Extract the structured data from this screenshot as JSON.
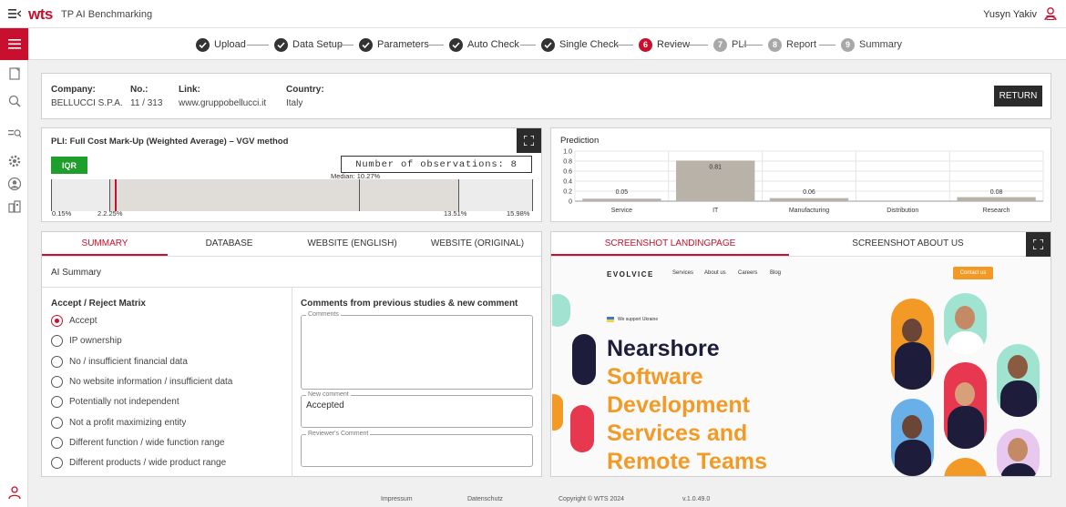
{
  "app": {
    "brand": "wts",
    "title": "TP AI Benchmarking",
    "user": "Yusyn Yakiv"
  },
  "steps": [
    {
      "label": "Upload",
      "number": "1",
      "state": "done"
    },
    {
      "label": "Data Setup",
      "number": "2",
      "state": "done"
    },
    {
      "label": "Parameters",
      "number": "3",
      "state": "done"
    },
    {
      "label": "Auto Check",
      "number": "4",
      "state": "done"
    },
    {
      "label": "Single Check",
      "number": "5",
      "state": "done"
    },
    {
      "label": "Review",
      "number": "6",
      "state": "active"
    },
    {
      "label": "PLI",
      "number": "7",
      "state": "pending"
    },
    {
      "label": "Report",
      "number": "8",
      "state": "pending"
    },
    {
      "label": "Summary",
      "number": "9",
      "state": "pending"
    }
  ],
  "company": {
    "company_label": "Company:",
    "company_value": "BELLUCCI S.P.A.",
    "no_label": "No.:",
    "no_value": "11 / 313",
    "link_label": "Link:",
    "link_value": "www.gruppobellucci.it",
    "country_label": "Country:",
    "country_value": "Italy",
    "return_label": "RETURN"
  },
  "pli": {
    "title": "PLI: Full Cost Mark-Up (Weighted Average) – VGV method",
    "iqr_label": "IQR",
    "observations": "Number of observations: 8",
    "median_label": "Median: 10.27%",
    "min_label": "0.15%",
    "q1_label": "2.2.25%",
    "q3_label": "13.51%",
    "max_label": "15.98%"
  },
  "chart_data": {
    "type": "bar",
    "title": "Prediction",
    "categories": [
      "Service",
      "IT",
      "Manufacturing",
      "Distribution",
      "Research"
    ],
    "values": [
      0.05,
      0.81,
      0.06,
      0,
      0.08
    ],
    "value_labels": [
      "0.05",
      "0.81",
      "0.06",
      "",
      "0.08"
    ],
    "ylim": [
      0,
      1.0
    ],
    "yticks": [
      "0",
      "0.2",
      "0.4",
      "0.6",
      "0.8",
      "1.0"
    ],
    "grid": true,
    "bar_color": "#b9b2a8"
  },
  "tabs_left": [
    "SUMMARY",
    "DATABASE",
    "WEBSITE (ENGLISH)",
    "WEBSITE (ORIGINAL)"
  ],
  "ai_summary_label": "AI Summary",
  "matrix": {
    "title": "Accept / Reject Matrix",
    "options": [
      "Accept",
      "IP ownership",
      "No / insufficient financial data",
      "No website information / insufficient data",
      "Potentially not independent",
      "Not a profit maximizing entity",
      "Different function / wide function range",
      "Different products / wide product range"
    ],
    "selected": "Accept"
  },
  "comments": {
    "title": "Comments from previous studies & new comment",
    "comments_legend": "Comments",
    "new_comment_legend": "New comment",
    "new_comment_value": "Accepted",
    "reviewer_legend": "Reviewer's Comment"
  },
  "tabs_right": [
    "SCREENSHOT LANDINGPAGE",
    "SCREENSHOT ABOUT US"
  ],
  "screenshot": {
    "logo": "EVOLVICE",
    "nav": [
      "Services",
      "About us",
      "Careers",
      "Blog"
    ],
    "contact": "Contact us",
    "badge": "We support Ukraine",
    "headline_1": "Nearshore",
    "headline_2": "Software",
    "headline_3": "Development",
    "headline_4": "Services and",
    "headline_5": "Remote Teams"
  },
  "footer": {
    "impressum": "Impressum",
    "datenschutz": "Datenschutz",
    "copyright": "Copyright © WTS 2024",
    "version": "v.1.0.49.0"
  },
  "colors": {
    "accent": "#c8102e",
    "dark": "#2b2b2b",
    "iqr_green": "#1e9e2a",
    "orange": "#f39a26",
    "navy": "#1d1d3b"
  }
}
